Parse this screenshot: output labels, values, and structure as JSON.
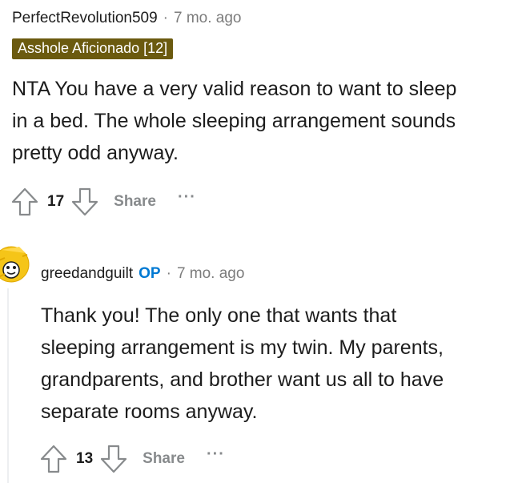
{
  "comment1": {
    "username": "PerfectRevolution509",
    "separator": "·",
    "time": "7 mo. ago",
    "flair": "Asshole Aficionado [12]",
    "body_lines": [
      "NTA You have a very valid reason to want to sleep",
      "in a bed. The whole sleeping arrangement sounds",
      "pretty odd anyway."
    ],
    "score": "17",
    "share_label": "Share",
    "more_label": "···"
  },
  "comment2": {
    "username": "greedandguilt",
    "op_badge": "OP",
    "separator": "·",
    "time": "7 mo. ago",
    "body_lines": [
      "Thank you! The only one that wants that",
      "sleeping arrangement is my twin. My parents,",
      "grandparents, and brother want us all to have",
      "separate rooms anyway."
    ],
    "score": "13",
    "share_label": "Share",
    "more_label": "···"
  },
  "colors": {
    "flair_bg": "#6b5a0f",
    "op_blue": "#0079d3",
    "avatar_yellow": "#f5c518"
  }
}
